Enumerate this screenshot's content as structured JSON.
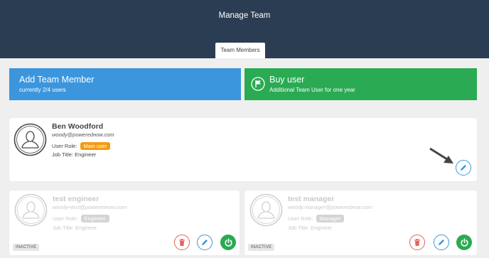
{
  "header": {
    "title": "Manage Team",
    "tab_label": "Team Members"
  },
  "actions": {
    "add": {
      "title": "Add Team Member",
      "subtitle": "currently 2/4 users"
    },
    "buy": {
      "title": "Buy user",
      "subtitle": "Additional Team User for one year"
    }
  },
  "members": [
    {
      "name": "Ben Woodford",
      "email": "woody@poweredнow.com",
      "role_label": "User Role:",
      "role": "Main user",
      "job_title_label": "Job Title:",
      "job_title": "Engineer"
    },
    {
      "name": "test engineer",
      "email": "woody+test@poweredнow.com",
      "role_label": "User Role:",
      "role": "Engineer",
      "job_title_label": "Job Title:",
      "job_title": "Engineer",
      "status": "INACTIVE"
    },
    {
      "name": "test manager",
      "email": "woody.manager@poweredнow.com",
      "role_label": "User Role:",
      "role": "Manager",
      "job_title_label": "Job Title:",
      "job_title": "Engineer",
      "status": "INACTIVE"
    }
  ],
  "colors": {
    "header_bg": "#2b3d52",
    "add_bg": "#3b96dd",
    "buy_bg": "#2aaa52",
    "main_badge": "#f39c12",
    "delete": "#e8615a",
    "power": "#2aaa52"
  },
  "icons": [
    "flag-icon",
    "avatar-icon",
    "pencil-icon",
    "trash-icon",
    "power-icon",
    "arrow-pointer-icon"
  ]
}
